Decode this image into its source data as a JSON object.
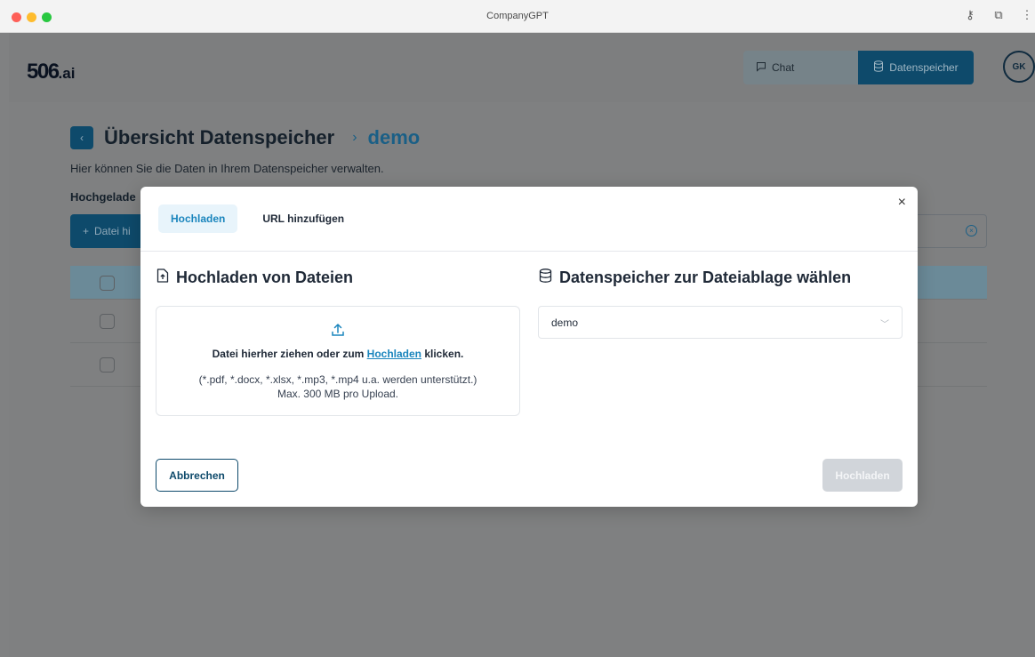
{
  "window": {
    "title": "CompanyGPT"
  },
  "nav": {
    "logo_main": "506",
    "logo_suffix": ".ai",
    "chat_label": "Chat",
    "datastore_label": "Datenspeicher",
    "avatar_initials": "GK"
  },
  "page": {
    "title": "Übersicht Datenspeicher",
    "breadcrumb_sep": "›",
    "breadcrumb_current": "demo",
    "subtitle": "Hier können Sie die Daten in Ihrem Datenspeicher verwalten.",
    "uploaded_label": "Hochgelade",
    "add_file_label": "Datei hi"
  },
  "modal": {
    "tabs": [
      {
        "label": "Hochladen",
        "active": true
      },
      {
        "label": "URL hinzufügen",
        "active": false
      }
    ],
    "left_title": "Hochladen von Dateien",
    "right_title": "Datenspeicher zur Dateiablage wählen",
    "dropzone": {
      "text_before": "Datei hierher ziehen oder zum ",
      "link_text": "Hochladen",
      "text_after": " klicken.",
      "formats": "(*.pdf, *.docx, *.xlsx, *.mp3, *.mp4 u.a. werden unterstützt.)",
      "limit": "Max. 300 MB pro Upload."
    },
    "select_value": "demo",
    "cancel_label": "Abbrechen",
    "upload_label": "Hochladen"
  },
  "colors": {
    "accent": "#1a85bd",
    "primary_dark": "#0e4a6b",
    "overlay": "#808182"
  }
}
